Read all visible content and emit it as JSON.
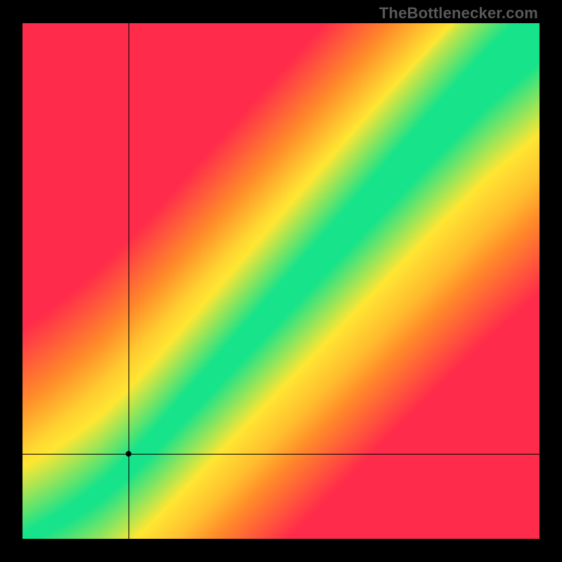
{
  "watermark": "TheBottlenecker.com",
  "chart_data": {
    "type": "heatmap",
    "title": "",
    "xlabel": "",
    "ylabel": "",
    "xlim": [
      0,
      1
    ],
    "ylim": [
      0,
      1
    ],
    "grid": false,
    "resolution": 120,
    "band": {
      "description": "Diagonal green 'no-bottleneck' band with slight upward curvature near origin; surrounded by yellow transition; red away from band. Top-left corner is red, bottom-right corner is red, top-right and along-diagonal are green/yellow.",
      "center_curve": [
        [
          0.0,
          0.0
        ],
        [
          0.05,
          0.025
        ],
        [
          0.1,
          0.055
        ],
        [
          0.15,
          0.09
        ],
        [
          0.2,
          0.135
        ],
        [
          0.25,
          0.185
        ],
        [
          0.3,
          0.24
        ],
        [
          0.4,
          0.35
        ],
        [
          0.5,
          0.46
        ],
        [
          0.6,
          0.57
        ],
        [
          0.7,
          0.68
        ],
        [
          0.8,
          0.79
        ],
        [
          0.9,
          0.895
        ],
        [
          1.0,
          0.985
        ]
      ],
      "green_halfwidth_start": 0.01,
      "green_halfwidth_end": 0.06,
      "yellow_extra_width": 0.035
    },
    "color_stops": {
      "red": "#ff2b4b",
      "orange": "#ff8a2a",
      "yellow": "#ffe733",
      "green": "#17e38a"
    },
    "crosshair": {
      "x": 0.205,
      "y": 0.165
    },
    "marker": {
      "x": 0.205,
      "y": 0.165
    }
  }
}
